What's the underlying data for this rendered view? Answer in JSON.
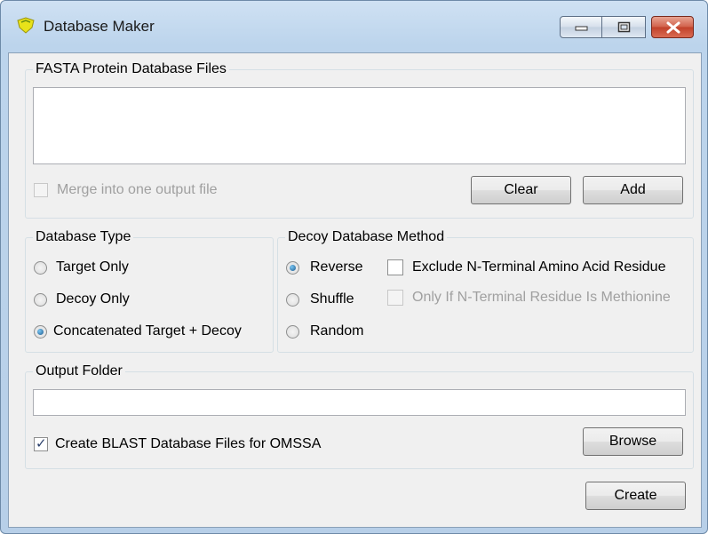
{
  "window": {
    "title": "Database Maker",
    "controls": {
      "minimize": "minimize",
      "maximize": "maximize",
      "close": "close"
    }
  },
  "fasta": {
    "legend": "FASTA Protein Database Files",
    "merge_label": "Merge into one output file",
    "merge_checked": false,
    "merge_enabled": false,
    "clear_label": "Clear",
    "add_label": "Add"
  },
  "database_type": {
    "legend": "Database Type",
    "options": [
      {
        "label": "Target Only",
        "selected": false
      },
      {
        "label": "Decoy Only",
        "selected": false
      },
      {
        "label": "Concatenated Target + Decoy",
        "selected": true
      }
    ]
  },
  "decoy_method": {
    "legend": "Decoy Database Method",
    "options": [
      {
        "label": "Reverse",
        "selected": true
      },
      {
        "label": "Shuffle",
        "selected": false
      },
      {
        "label": "Random",
        "selected": false
      }
    ],
    "exclude_label": "Exclude N-Terminal Amino Acid Residue",
    "exclude_checked": false,
    "only_if_label": "Only If N-Terminal Residue Is Methionine",
    "only_if_enabled": false
  },
  "output": {
    "legend": "Output Folder",
    "folder_value": "",
    "blast_label": "Create BLAST Database Files for OMSSA",
    "blast_checked": true,
    "browse_label": "Browse"
  },
  "create_label": "Create",
  "colors": {
    "title_gradient_top": "#cfe1f3",
    "client_bg": "#f0f0f0",
    "close_red": "#c1412a"
  }
}
